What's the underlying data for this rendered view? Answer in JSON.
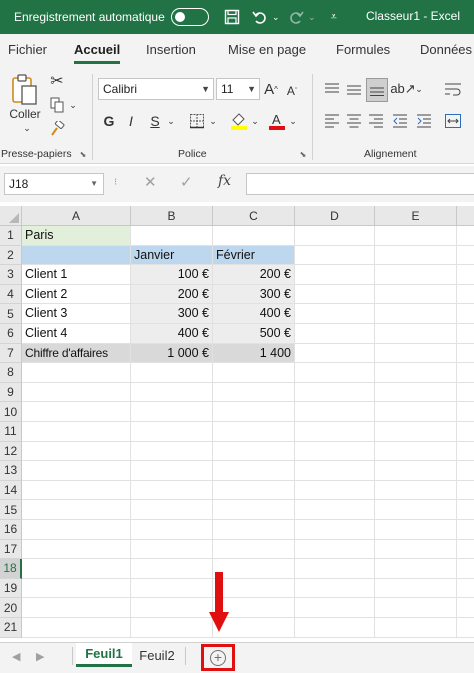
{
  "titlebar": {
    "autosave_label": "Enregistrement automatique",
    "document": "Classeur1 - Excel"
  },
  "ribbon_tabs": [
    "Fichier",
    "Accueil",
    "Insertion",
    "Mise en page",
    "Formules",
    "Données"
  ],
  "ribbon": {
    "paste_label": "Coller",
    "font_name": "Calibri",
    "font_size": "11",
    "bold": "G",
    "italic": "I",
    "underline": "S",
    "groups": {
      "clipboard": "Presse-papiers",
      "font": "Police",
      "alignment": "Alignement"
    }
  },
  "formula_bar": {
    "name_box": "J18",
    "fx": "fx"
  },
  "grid": {
    "columns": [
      "A",
      "B",
      "C",
      "D",
      "E"
    ],
    "rows": [
      "1",
      "2",
      "3",
      "4",
      "5",
      "6",
      "7",
      "8",
      "9",
      "10",
      "11",
      "12",
      "13",
      "14",
      "15",
      "16",
      "17",
      "18",
      "19",
      "20",
      "21"
    ],
    "selected_row": "18",
    "cells": {
      "A1": "Paris",
      "B2": "Janvier",
      "C2": "Février",
      "A3": "Client 1",
      "B3": "100 €",
      "C3": "200 €",
      "A4": "Client 2",
      "B4": "200 €",
      "C4": "300 €",
      "A5": "Client 3",
      "B5": "300 €",
      "C5": "400 €",
      "A6": "Client 4",
      "B6": "400 €",
      "C6": "500 €",
      "A7": "Chiffre d'affaires",
      "B7": "1 000 €",
      "C7": "1 400"
    },
    "colors": {
      "a1_fill": "#e2efda",
      "header_fill": "#bdd7ee",
      "data_fill": "#ededed",
      "total_fill": "#d9d9d9"
    }
  },
  "sheets": [
    "Feuil1",
    "Feuil2"
  ],
  "active_sheet": "Feuil1",
  "colors": {
    "accent": "#217346",
    "highlight": "#e01010"
  }
}
